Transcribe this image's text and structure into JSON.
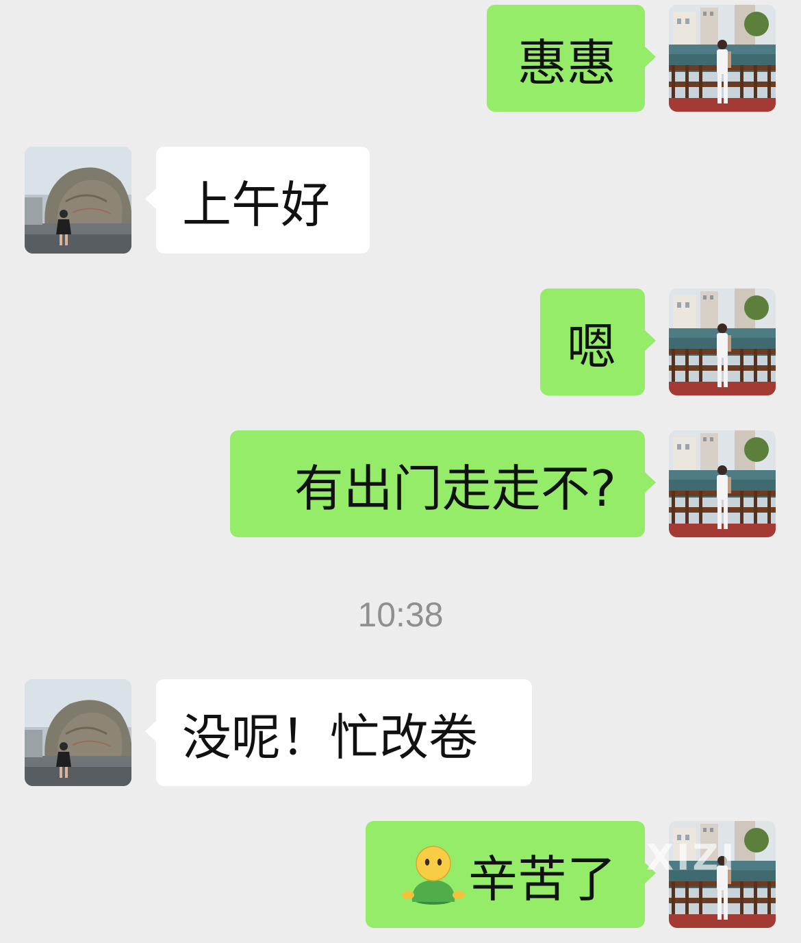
{
  "conversation": {
    "messages": [
      {
        "side": "outgoing",
        "text": "惠惠"
      },
      {
        "side": "incoming",
        "text": "上午好"
      },
      {
        "side": "outgoing",
        "text": "嗯"
      },
      {
        "side": "outgoing",
        "text": "有出门走走不?"
      },
      {
        "side": "incoming",
        "text": "没呢！忙改卷"
      },
      {
        "side": "outgoing",
        "emoji": "silly-person-emoji",
        "text": "辛苦了"
      }
    ],
    "timestamp": "10:38"
  },
  "avatars": {
    "self": "self-avatar-photo",
    "contact": "contact-avatar-photo"
  },
  "colors": {
    "background": "#ededed",
    "outgoing_bubble": "#95ec69",
    "incoming_bubble": "#ffffff",
    "timestamp_text": "#8f8f8f"
  },
  "watermark": "XIZI"
}
